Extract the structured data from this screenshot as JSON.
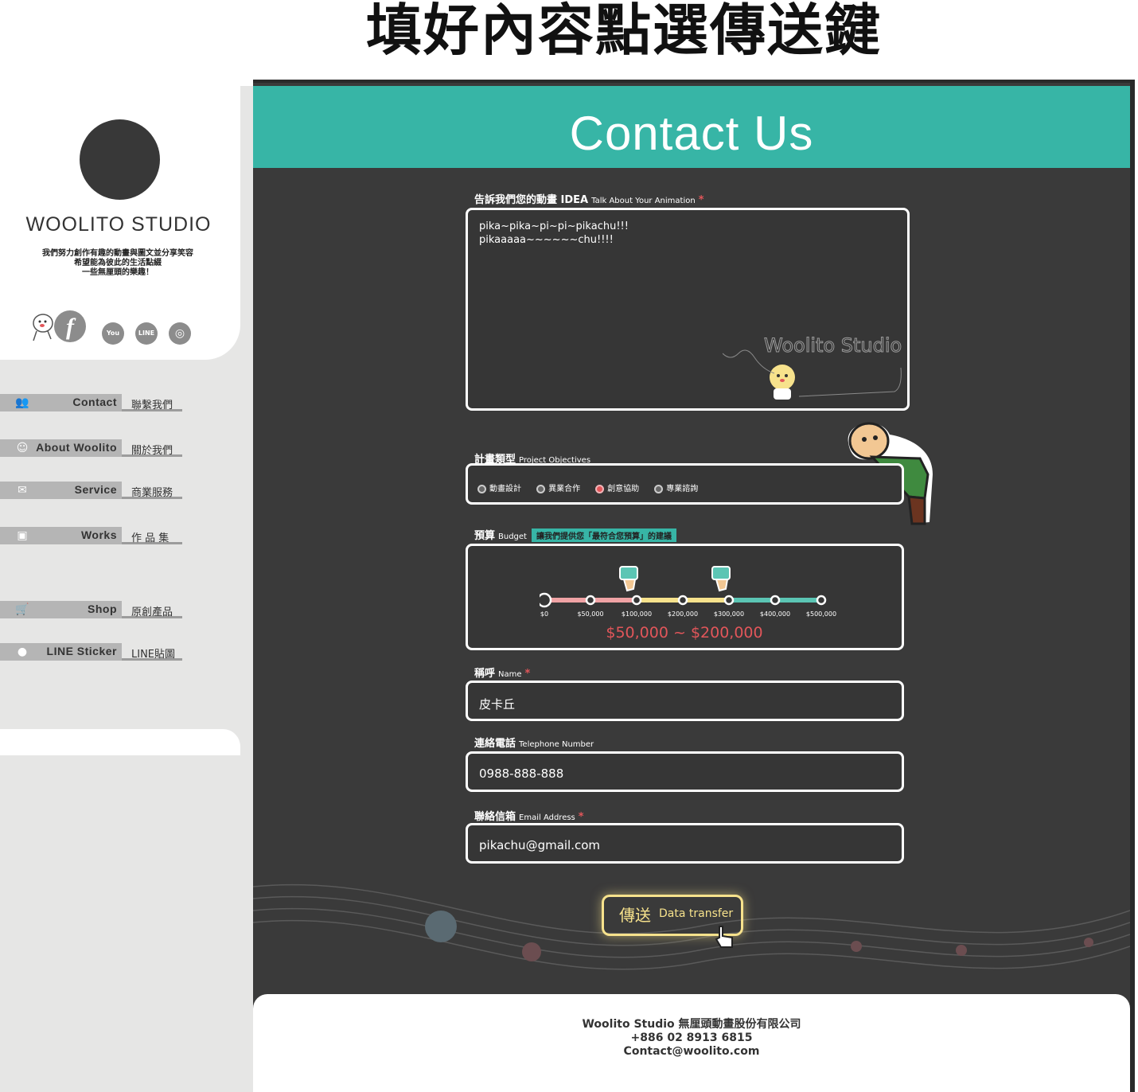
{
  "instruction": {
    "text": "填好內容點選傳送鍵"
  },
  "sidebar": {
    "studio_name": "WOOLITO STUDIO",
    "tagline": [
      "我們努力創作有趣的動畫與圖文並分享笑容",
      "希望能為彼此的生活點綴",
      "一些無厘頭的樂趣！"
    ],
    "social": [
      {
        "icon": "facebook-icon",
        "glyph": "f"
      },
      {
        "icon": "youtube-icon",
        "glyph": "You"
      },
      {
        "icon": "line-icon",
        "glyph": "LINE"
      },
      {
        "icon": "instagram-icon",
        "glyph": "◎"
      }
    ],
    "nav": [
      {
        "en": "Contact",
        "zh": "聯繫我們",
        "icon": "people-icon",
        "glyph": "👥"
      },
      {
        "en": "About Woolito",
        "zh": "關於我們",
        "icon": "character-icon",
        "glyph": "☺"
      },
      {
        "en": "Service",
        "zh": "商業服務",
        "icon": "envelope-icon",
        "glyph": "✉"
      },
      {
        "en": "Works",
        "zh": "作 品 集",
        "icon": "monitor-icon",
        "glyph": "▣"
      },
      {
        "en": "Shop",
        "zh": "原創產品",
        "icon": "cart-icon",
        "glyph": "🛒"
      },
      {
        "en": "LINE Sticker",
        "zh": "LINE貼圖",
        "icon": "speech-bubble-icon",
        "glyph": "●"
      }
    ]
  },
  "header": {
    "title": "Contact Us"
  },
  "form": {
    "idea": {
      "label": "告訴我們您的動畫 IDEA",
      "sub": "Talk About Your Animation",
      "required": "*",
      "value": "pika~pika~pi~pi~pikachu!!!\npikaaaaa~~~~~~chu!!!!",
      "watermark": "Woolito Studio"
    },
    "project": {
      "label": "計畫類型",
      "sub": "Project Objectives",
      "options": [
        "動畫設計",
        "異業合作",
        "創意協助",
        "專業諮詢"
      ],
      "selected_index": 2
    },
    "budget": {
      "label": "預算",
      "sub": "Budget",
      "tag": "讓我們提供您「最符合您預算」的建議",
      "ticks": [
        "$0",
        "$50,000",
        "$100,000",
        "$200,000",
        "$300,000",
        "$400,000",
        "$500,000"
      ],
      "range_low_index": 1,
      "range_high_index": 3,
      "range_text": "$50,000 ~ $200,000",
      "segment_colors": [
        "#f0a3a5",
        "#f0a3a5",
        "#f7e28c",
        "#f7e28c",
        "#5bc5b4",
        "#5bc5b4"
      ]
    },
    "name": {
      "label": "稱呼",
      "sub": "Name",
      "required": "*",
      "value": "皮卡丘"
    },
    "phone": {
      "label": "連絡電話",
      "sub": "Telephone Number",
      "value": "0988-888-888"
    },
    "email": {
      "label": "聯絡信箱",
      "sub": "Email Address",
      "required": "*",
      "value": "pikachu@gmail.com"
    },
    "submit": {
      "zh": "傳送",
      "en": "Data transfer"
    }
  },
  "footer": {
    "company": "Woolito Studio 無厘頭動畫股份有限公司",
    "phone": "+886 02 8913 6815",
    "email": "Contact@woolito.com"
  },
  "colors": {
    "accent": "#37b5a6",
    "panel": "#3a3a3a",
    "alert": "#e2565a",
    "highlight": "#f7e28c"
  }
}
